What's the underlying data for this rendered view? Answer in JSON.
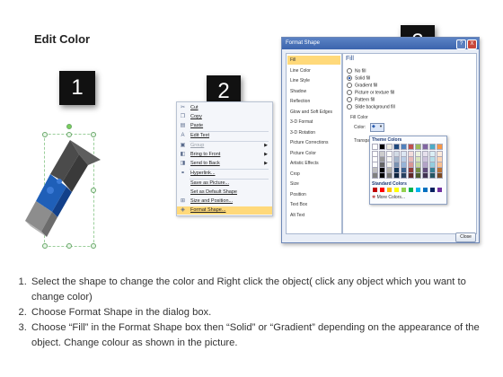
{
  "slide": {
    "title": "Edit Color"
  },
  "steps": {
    "one": "1",
    "two": "2",
    "three": "3"
  },
  "context_menu": {
    "items": [
      {
        "label": "Cut",
        "icon": "scissors-icon",
        "glyph": "✂"
      },
      {
        "label": "Copy",
        "icon": "copy-icon",
        "glyph": "❐"
      },
      {
        "label": "Paste",
        "icon": "paste-icon",
        "glyph": "▤"
      },
      {
        "label": "Edit Text",
        "icon": "edit-text-icon",
        "glyph": "A"
      },
      {
        "label": "Group",
        "icon": "group-icon",
        "glyph": "▣",
        "disabled": true,
        "submenu": true
      },
      {
        "label": "Bring to Front",
        "icon": "bring-front-icon",
        "glyph": "◧",
        "submenu": true
      },
      {
        "label": "Send to Back",
        "icon": "send-back-icon",
        "glyph": "◨",
        "submenu": true
      },
      {
        "label": "Hyperlink...",
        "icon": "hyperlink-icon",
        "glyph": "⚭"
      },
      {
        "label": "Save as Picture...",
        "icon": "",
        "glyph": ""
      },
      {
        "label": "Set as Default Shape",
        "icon": "",
        "glyph": ""
      },
      {
        "label": "Size and Position...",
        "icon": "size-position-icon",
        "glyph": "⊞"
      },
      {
        "label": "Format Shape...",
        "icon": "format-shape-icon",
        "glyph": "◈",
        "highlighted": true
      }
    ]
  },
  "dialog": {
    "title": "Format Shape",
    "help": "?",
    "close_x": "X",
    "nav": [
      "Fill",
      "Line Color",
      "Line Style",
      "Shadow",
      "Reflection",
      "Glow and Soft Edges",
      "3-D Format",
      "3-D Rotation",
      "Picture Corrections",
      "Picture Color",
      "Artistic Effects",
      "Crop",
      "Size",
      "Position",
      "Text Box",
      "Alt Text"
    ],
    "selected_nav": "Fill",
    "fill_heading": "Fill",
    "fill_options": [
      {
        "label": "No fill",
        "checked": false
      },
      {
        "label": "Solid fill",
        "checked": true
      },
      {
        "label": "Gradient fill",
        "checked": false
      },
      {
        "label": "Picture or texture fill",
        "checked": false
      },
      {
        "label": "Pattern fill",
        "checked": false
      },
      {
        "label": "Slide background fill",
        "checked": false
      }
    ],
    "fill_color_label": "Fill Color",
    "color_label": "Color:",
    "transparency_label": "Transpar",
    "close_button": "Close"
  },
  "color_picker": {
    "theme_heading": "Theme Colors",
    "standard_heading": "Standard Colors",
    "more_colors": "More Colors...",
    "theme_top": [
      "#ffffff",
      "#000000",
      "#eeece1",
      "#1f497d",
      "#4f81bd",
      "#c0504d",
      "#9bbb59",
      "#8064a2",
      "#4bacc6",
      "#f79646"
    ],
    "standard": [
      "#c00000",
      "#ff0000",
      "#ffc000",
      "#ffff00",
      "#92d050",
      "#00b050",
      "#00b0f0",
      "#0070c0",
      "#002060",
      "#7030a0"
    ]
  },
  "instructions": [
    "Select the shape to change the color and Right click the object( click any object which you want to change color)",
    "Choose Format Shape in the dialog box.",
    "Choose “Fill” in the Format Shape box then “Solid” or “Gradient” depending on the appearance of the object. Change colour as shown in the picture."
  ]
}
